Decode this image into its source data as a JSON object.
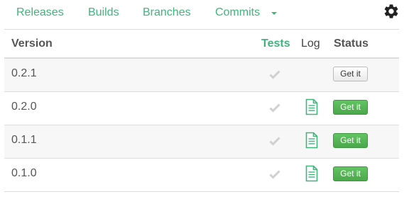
{
  "nav": {
    "items": [
      {
        "label": "Releases"
      },
      {
        "label": "Builds"
      },
      {
        "label": "Branches"
      },
      {
        "label": "Commits"
      }
    ],
    "commits_caret_icon": "caret-down-icon",
    "settings_icon": "gear-icon"
  },
  "table": {
    "headers": {
      "version": "Version",
      "tests": "Tests",
      "log": "Log",
      "status": "Status"
    },
    "rows": [
      {
        "version": "0.2.1",
        "tests_icon": "check-icon",
        "has_log": false,
        "button_label": "Get it",
        "button_style": "default"
      },
      {
        "version": "0.2.0",
        "tests_icon": "check-icon",
        "has_log": true,
        "button_label": "Get it",
        "button_style": "success"
      },
      {
        "version": "0.1.1",
        "tests_icon": "check-icon",
        "has_log": true,
        "button_label": "Get it",
        "button_style": "success"
      },
      {
        "version": "0.1.0",
        "tests_icon": "check-icon",
        "has_log": true,
        "button_label": "Get it",
        "button_style": "success"
      }
    ]
  },
  "colors": {
    "accent": "#3fb57c",
    "success_button": "#5cb85c",
    "check_muted": "#d0d0d0",
    "row_alt": "#f7f7f7",
    "border": "#dddddd"
  }
}
